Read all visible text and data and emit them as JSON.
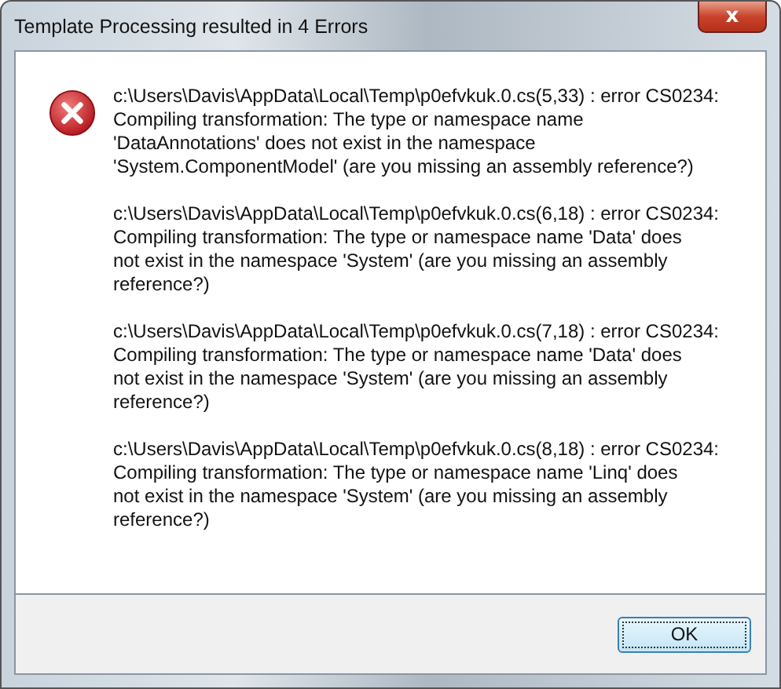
{
  "window": {
    "title": "Template Processing resulted in 4 Errors",
    "close_label": "x"
  },
  "errors": [
    {
      "lines": [
        "c:\\Users\\Davis\\AppData\\Local\\Temp\\p0efvkuk.0.cs(5,33) : error CS0234:",
        "Compiling transformation: The type or namespace name",
        "'DataAnnotations' does not exist in the namespace",
        "'System.ComponentModel' (are you missing an assembly reference?)"
      ]
    },
    {
      "lines": [
        "c:\\Users\\Davis\\AppData\\Local\\Temp\\p0efvkuk.0.cs(6,18) : error CS0234:",
        "Compiling transformation: The type or namespace name 'Data' does",
        "not exist in the namespace 'System' (are you missing an assembly",
        "reference?)"
      ]
    },
    {
      "lines": [
        "c:\\Users\\Davis\\AppData\\Local\\Temp\\p0efvkuk.0.cs(7,18) : error CS0234:",
        "Compiling transformation: The type or namespace name 'Data' does",
        "not exist in the namespace 'System' (are you missing an assembly",
        "reference?)"
      ]
    },
    {
      "lines": [
        "c:\\Users\\Davis\\AppData\\Local\\Temp\\p0efvkuk.0.cs(8,18) : error CS0234:",
        "Compiling transformation: The type or namespace name 'Linq' does",
        "not exist in the namespace 'System' (are you missing an assembly",
        "reference?)"
      ]
    }
  ],
  "buttons": [
    {
      "label": "OK",
      "selected": true
    }
  ]
}
